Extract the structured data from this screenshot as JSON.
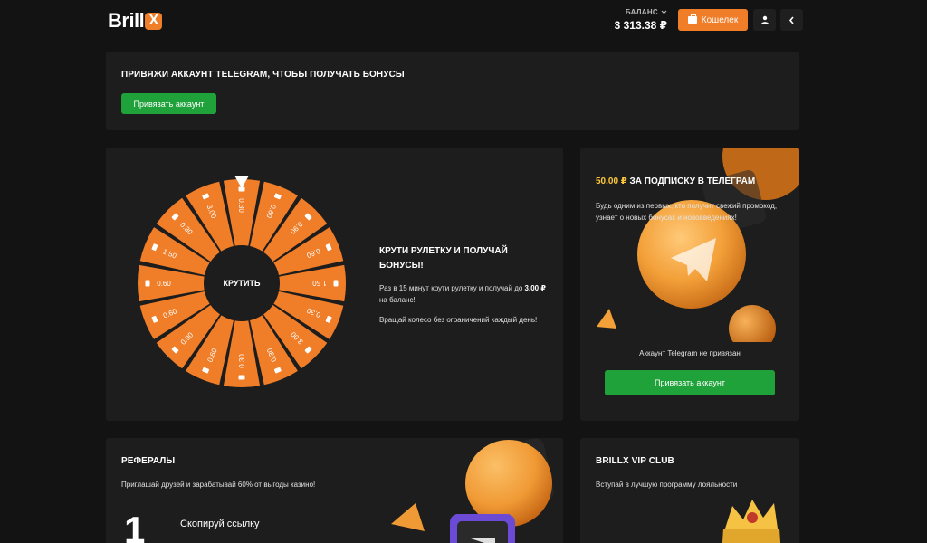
{
  "header": {
    "logo_text": "Brill",
    "logo_x": "X",
    "balance_label": "БАЛАНС",
    "balance_value": "3 313.38 ₽",
    "wallet_label": "Кошелек"
  },
  "telegram_bind": {
    "title": "ПРИВЯЖИ АККАУНТ TELEGRAM, ЧТОБЫ ПОЛУЧАТЬ БОНУСЫ",
    "button": "Привязать аккаунт"
  },
  "wheel": {
    "center_label": "КРУТИТЬ",
    "segments": [
      "0.30",
      "0.60",
      "0.90",
      "0.60",
      "1.50",
      "0.30",
      "3.00",
      "0.30",
      "0.30",
      "0.60",
      "0.90",
      "0.60",
      "0.60",
      "1.50",
      "0.30",
      "3.00"
    ],
    "title": "КРУТИ РУЛЕТКУ И ПОЛУЧАЙ БОНУСЫ!",
    "desc_before": "Раз в 15 минут крути рулетку и получай до ",
    "desc_amount": "3.00 ₽",
    "desc_after": " на баланс!",
    "note": "Вращай колесо без ограничений каждый день!"
  },
  "subscription": {
    "amount": "50.00 ₽",
    "title_rest": " ЗА ПОДПИСКУ В ТЕЛЕГРАМ",
    "desc": "Будь одним из первых, кто получит свежий промокод, узнает о новых бонусах и нововведениях!",
    "status": "Аккаунт Telegram не привязан",
    "button": "Привязать аккаунт"
  },
  "referrals": {
    "title": "РЕФЕРАЛЫ",
    "desc": "Приглашай друзей и зарабатывай 60% от выгоды казино!",
    "step_number": "1",
    "step_text": "Скопируй ссылку"
  },
  "vip": {
    "title": "BRILLX VIP CLUB",
    "desc": "Вступай в лучшую программу лояльности"
  },
  "colors": {
    "accent": "#f07d28",
    "green": "#1fa23a",
    "gold": "#ffc83a",
    "card": "#1d1d1d",
    "background": "#131313"
  },
  "icons": [
    "chevron-down-icon",
    "wallet-icon",
    "user-icon",
    "chevron-left-icon",
    "telegram-icon",
    "coins-icon",
    "pointer-icon"
  ]
}
